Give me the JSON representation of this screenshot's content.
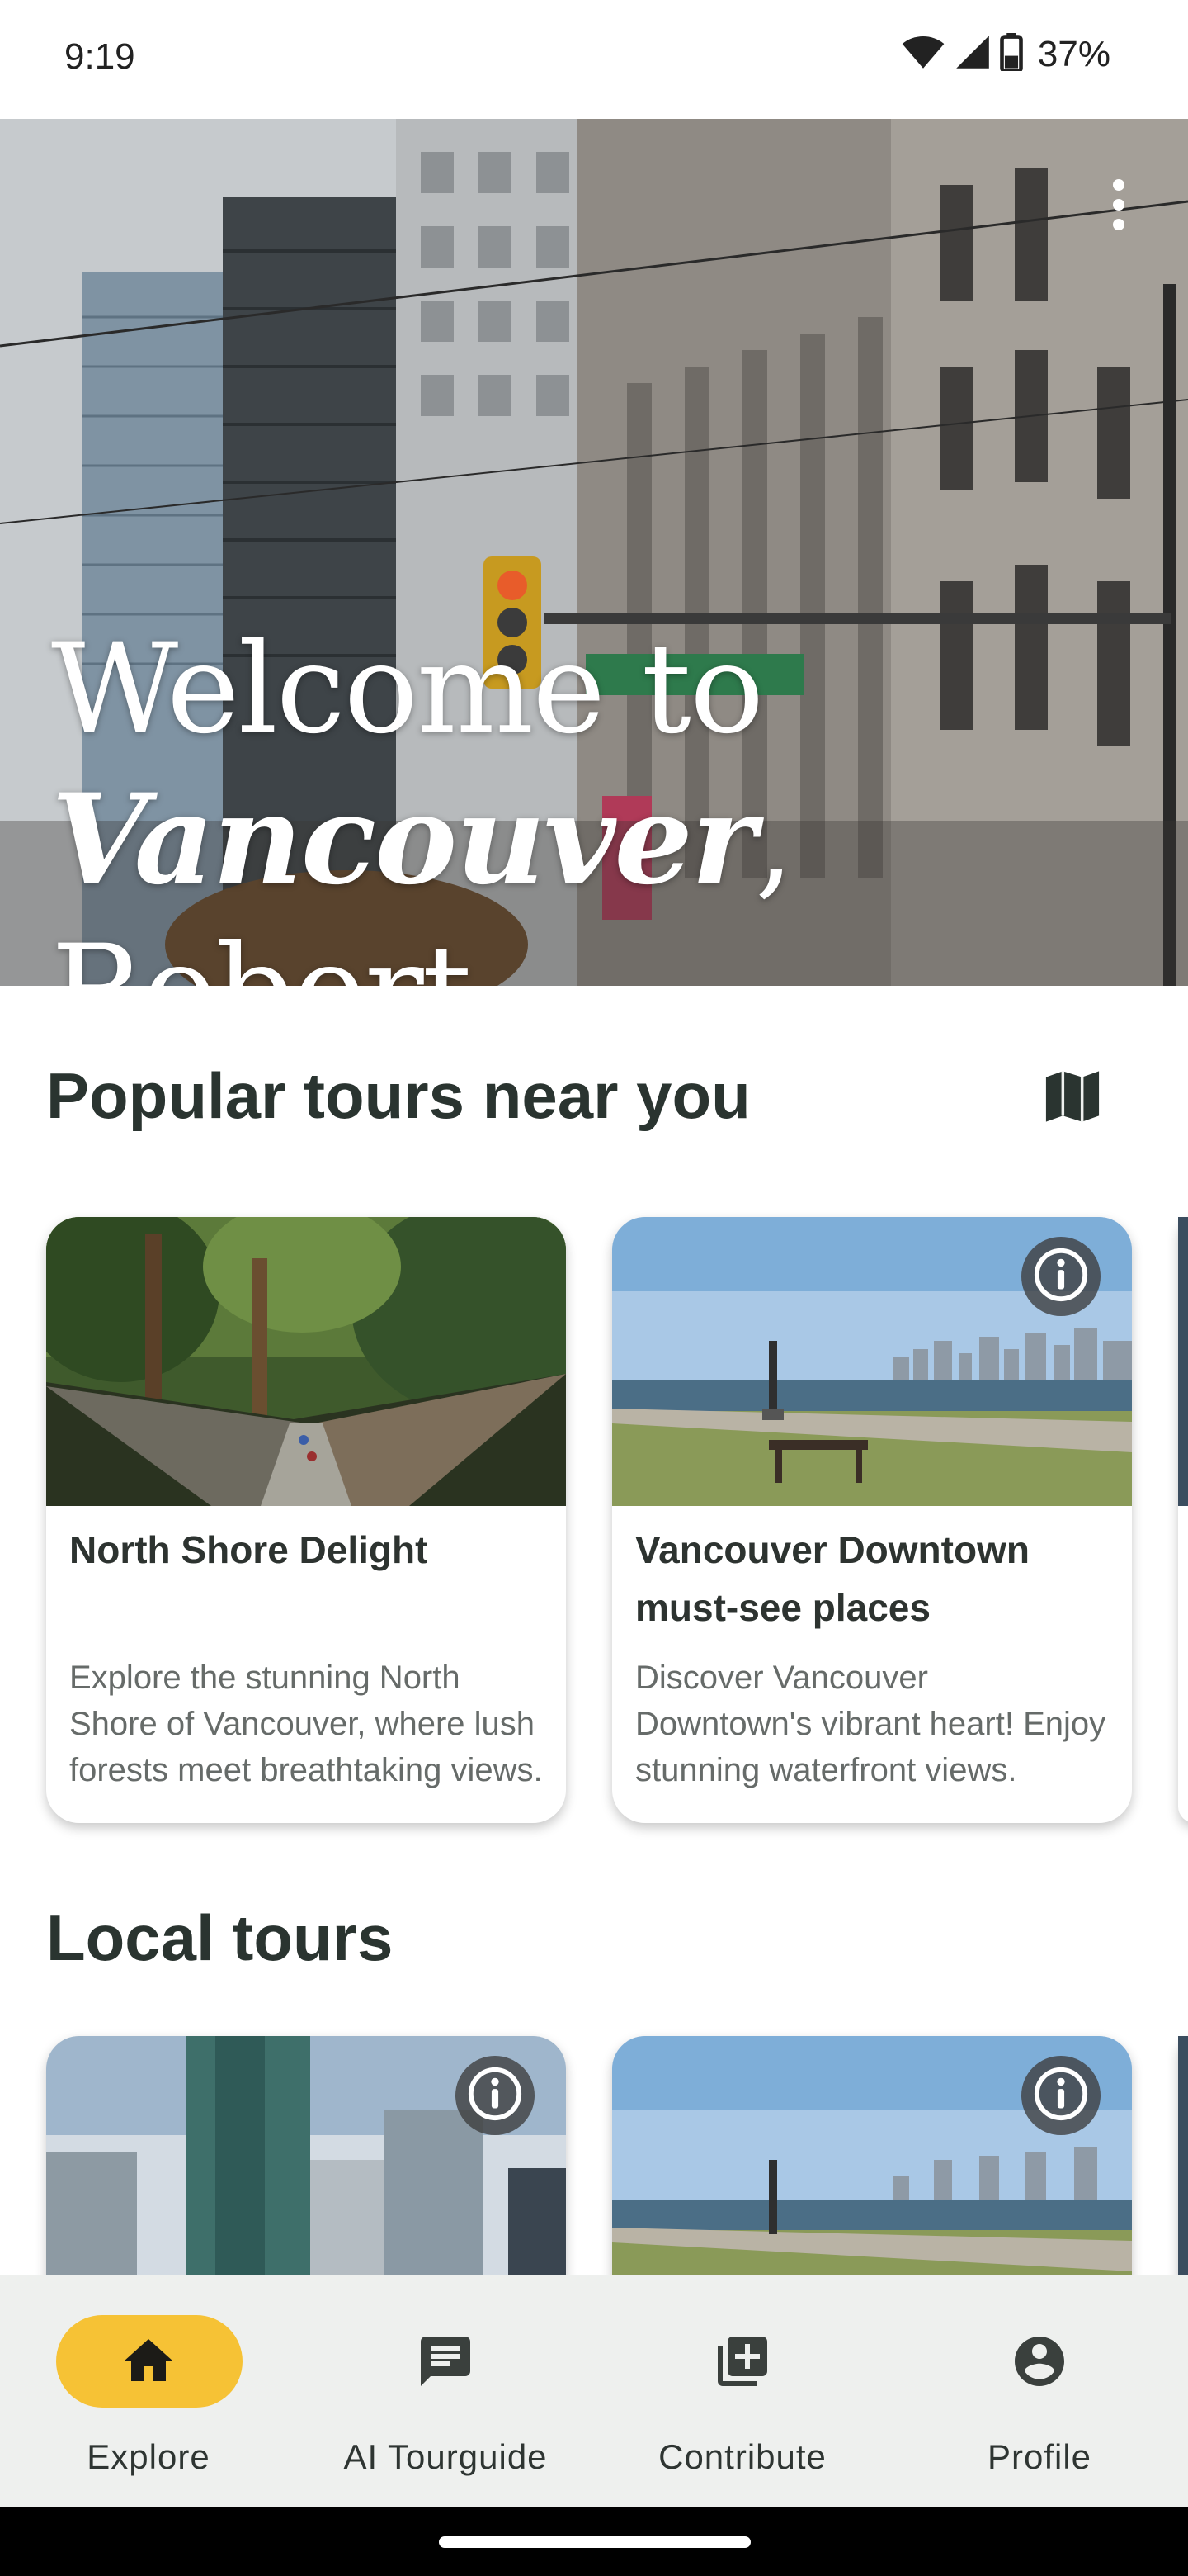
{
  "status_bar": {
    "time": "9:19",
    "battery_percent": "37%",
    "icons": [
      "wifi-icon",
      "cell-signal-icon",
      "battery-icon"
    ]
  },
  "hero": {
    "greeting_line1": "Welcome to",
    "city": "Vancouver",
    "greeting_suffix": ", Robert",
    "menu_icon": "more-vert-icon"
  },
  "popular_section": {
    "title": "Popular tours near you",
    "map_icon": "map-icon",
    "cards": [
      {
        "title": "North Shore Delight",
        "description": "Explore the stunning North Shore of Vancouver, where lush forests meet breathtaking views.",
        "has_info_badge": false
      },
      {
        "title": "Vancouver Downtown must-see places",
        "description": "Discover Vancouver Downtown's vibrant heart! Enjoy stunning waterfront views.",
        "has_info_badge": true
      }
    ]
  },
  "local_section": {
    "title": "Local tours",
    "cards": [
      {
        "has_info_badge": true
      },
      {
        "has_info_badge": true
      }
    ]
  },
  "bottom_nav": {
    "items": [
      {
        "label": "Explore",
        "icon": "home-icon",
        "active": true
      },
      {
        "label": "AI Tourguide",
        "icon": "chat-icon",
        "active": false
      },
      {
        "label": "Contribute",
        "icon": "add-box-icon",
        "active": false
      },
      {
        "label": "Profile",
        "icon": "account-circle-icon",
        "active": false
      }
    ]
  },
  "colors": {
    "accent": "#f6c235",
    "text_primary": "#2a3430",
    "text_secondary": "#666b69",
    "nav_bg": "#eef0ee"
  }
}
